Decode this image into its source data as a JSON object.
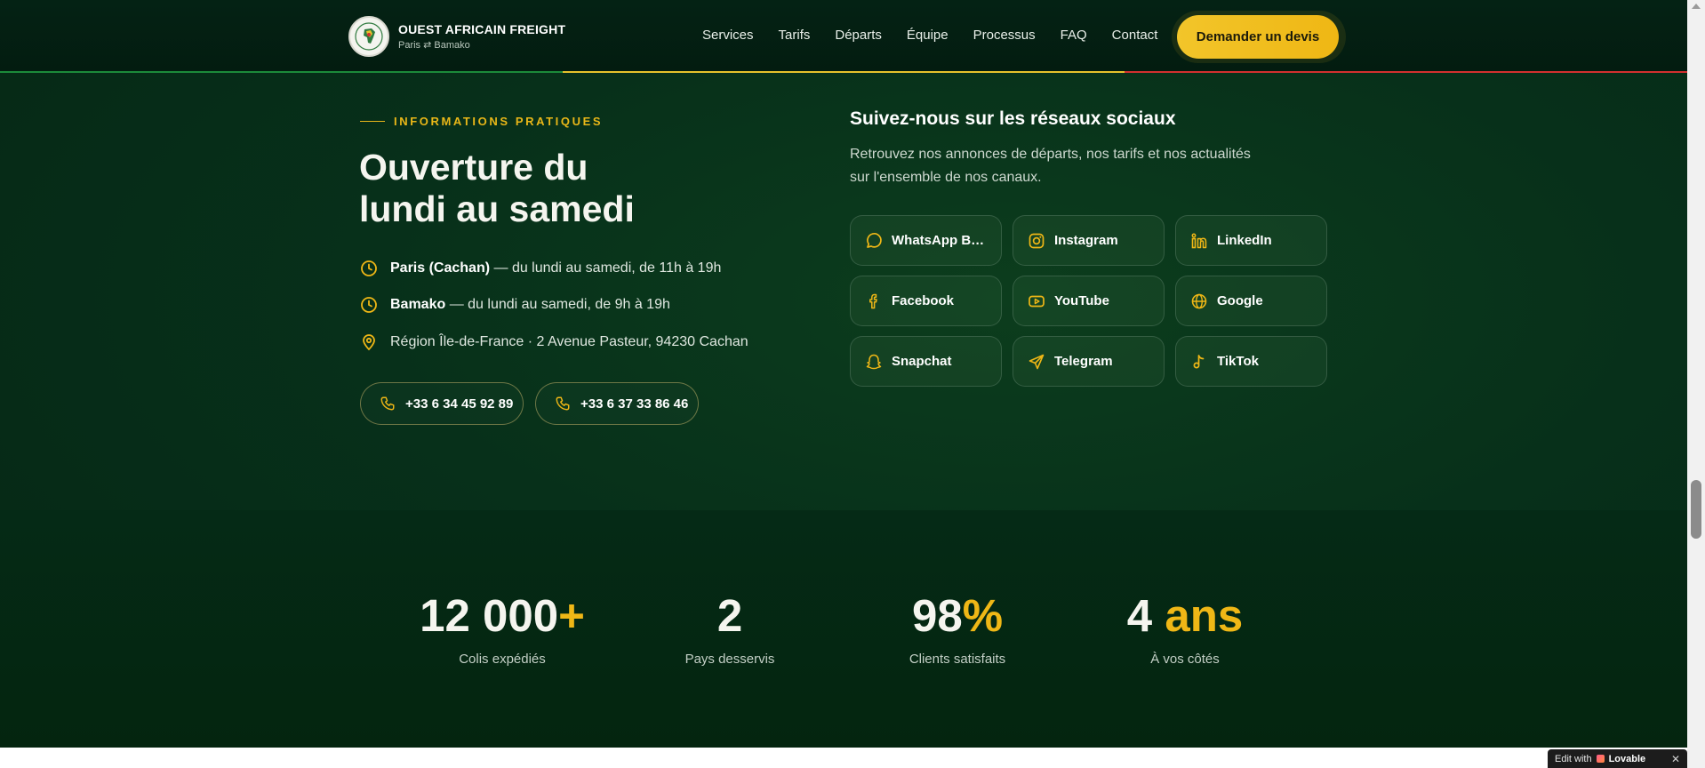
{
  "header": {
    "brand_name": "OUEST AFRICAIN FREIGHT",
    "brand_sub": "Paris ⇄ Bamako",
    "nav": [
      "Services",
      "Tarifs",
      "Départs",
      "Équipe",
      "Processus",
      "FAQ",
      "Contact"
    ],
    "cta_label": "Demander un devis",
    "flag_colors": [
      "#1b8a3a",
      "#e6c12c",
      "#d3302f"
    ]
  },
  "info": {
    "eyebrow": "INFORMATIONS PRATIQUES",
    "title_line1": "Ouverture du",
    "title_line2": "lundi au samedi",
    "rows": [
      {
        "icon": "clock-icon",
        "strong": "Paris (Cachan)",
        "text": " — du lundi au samedi, de 11h à 19h"
      },
      {
        "icon": "clock-icon",
        "strong": "Bamako",
        "text": " — du lundi au samedi, de 9h à 19h"
      },
      {
        "icon": "map-pin-icon",
        "strong": "",
        "text": "Région Île-de-France · 2 Avenue Pasteur, 94230 Cachan"
      }
    ],
    "phones": [
      "+33 6 34 45 92 89",
      "+33 6 37 33 86 46"
    ]
  },
  "social": {
    "title": "Suivez-nous sur les réseaux sociaux",
    "description": "Retrouvez nos annonces de départs, nos tarifs et nos actualités sur l'ensemble de nos canaux.",
    "items": [
      {
        "label": "WhatsApp Bu...",
        "icon": "whatsapp-icon"
      },
      {
        "label": "Instagram",
        "icon": "instagram-icon"
      },
      {
        "label": "LinkedIn",
        "icon": "linkedin-icon"
      },
      {
        "label": "Facebook",
        "icon": "facebook-icon"
      },
      {
        "label": "YouTube",
        "icon": "youtube-icon"
      },
      {
        "label": "Google",
        "icon": "globe-icon"
      },
      {
        "label": "Snapchat",
        "icon": "ghost-icon"
      },
      {
        "label": "Telegram",
        "icon": "send-icon"
      },
      {
        "label": "TikTok",
        "icon": "music-note-icon"
      }
    ]
  },
  "stats": [
    {
      "value": "12 000",
      "accent": "+",
      "label": "Colis expédiés"
    },
    {
      "value": "2",
      "accent": "",
      "label": "Pays desservis"
    },
    {
      "value": "98",
      "accent": "%",
      "label": "Clients satisfaits"
    },
    {
      "value": "4",
      "accent": " ans",
      "label": "À vos côtés"
    }
  ],
  "badge": {
    "prefix": "Edit with",
    "brand": "Lovable",
    "close": "✕"
  },
  "colors": {
    "accent": "#efb716",
    "background": "#07301a"
  }
}
